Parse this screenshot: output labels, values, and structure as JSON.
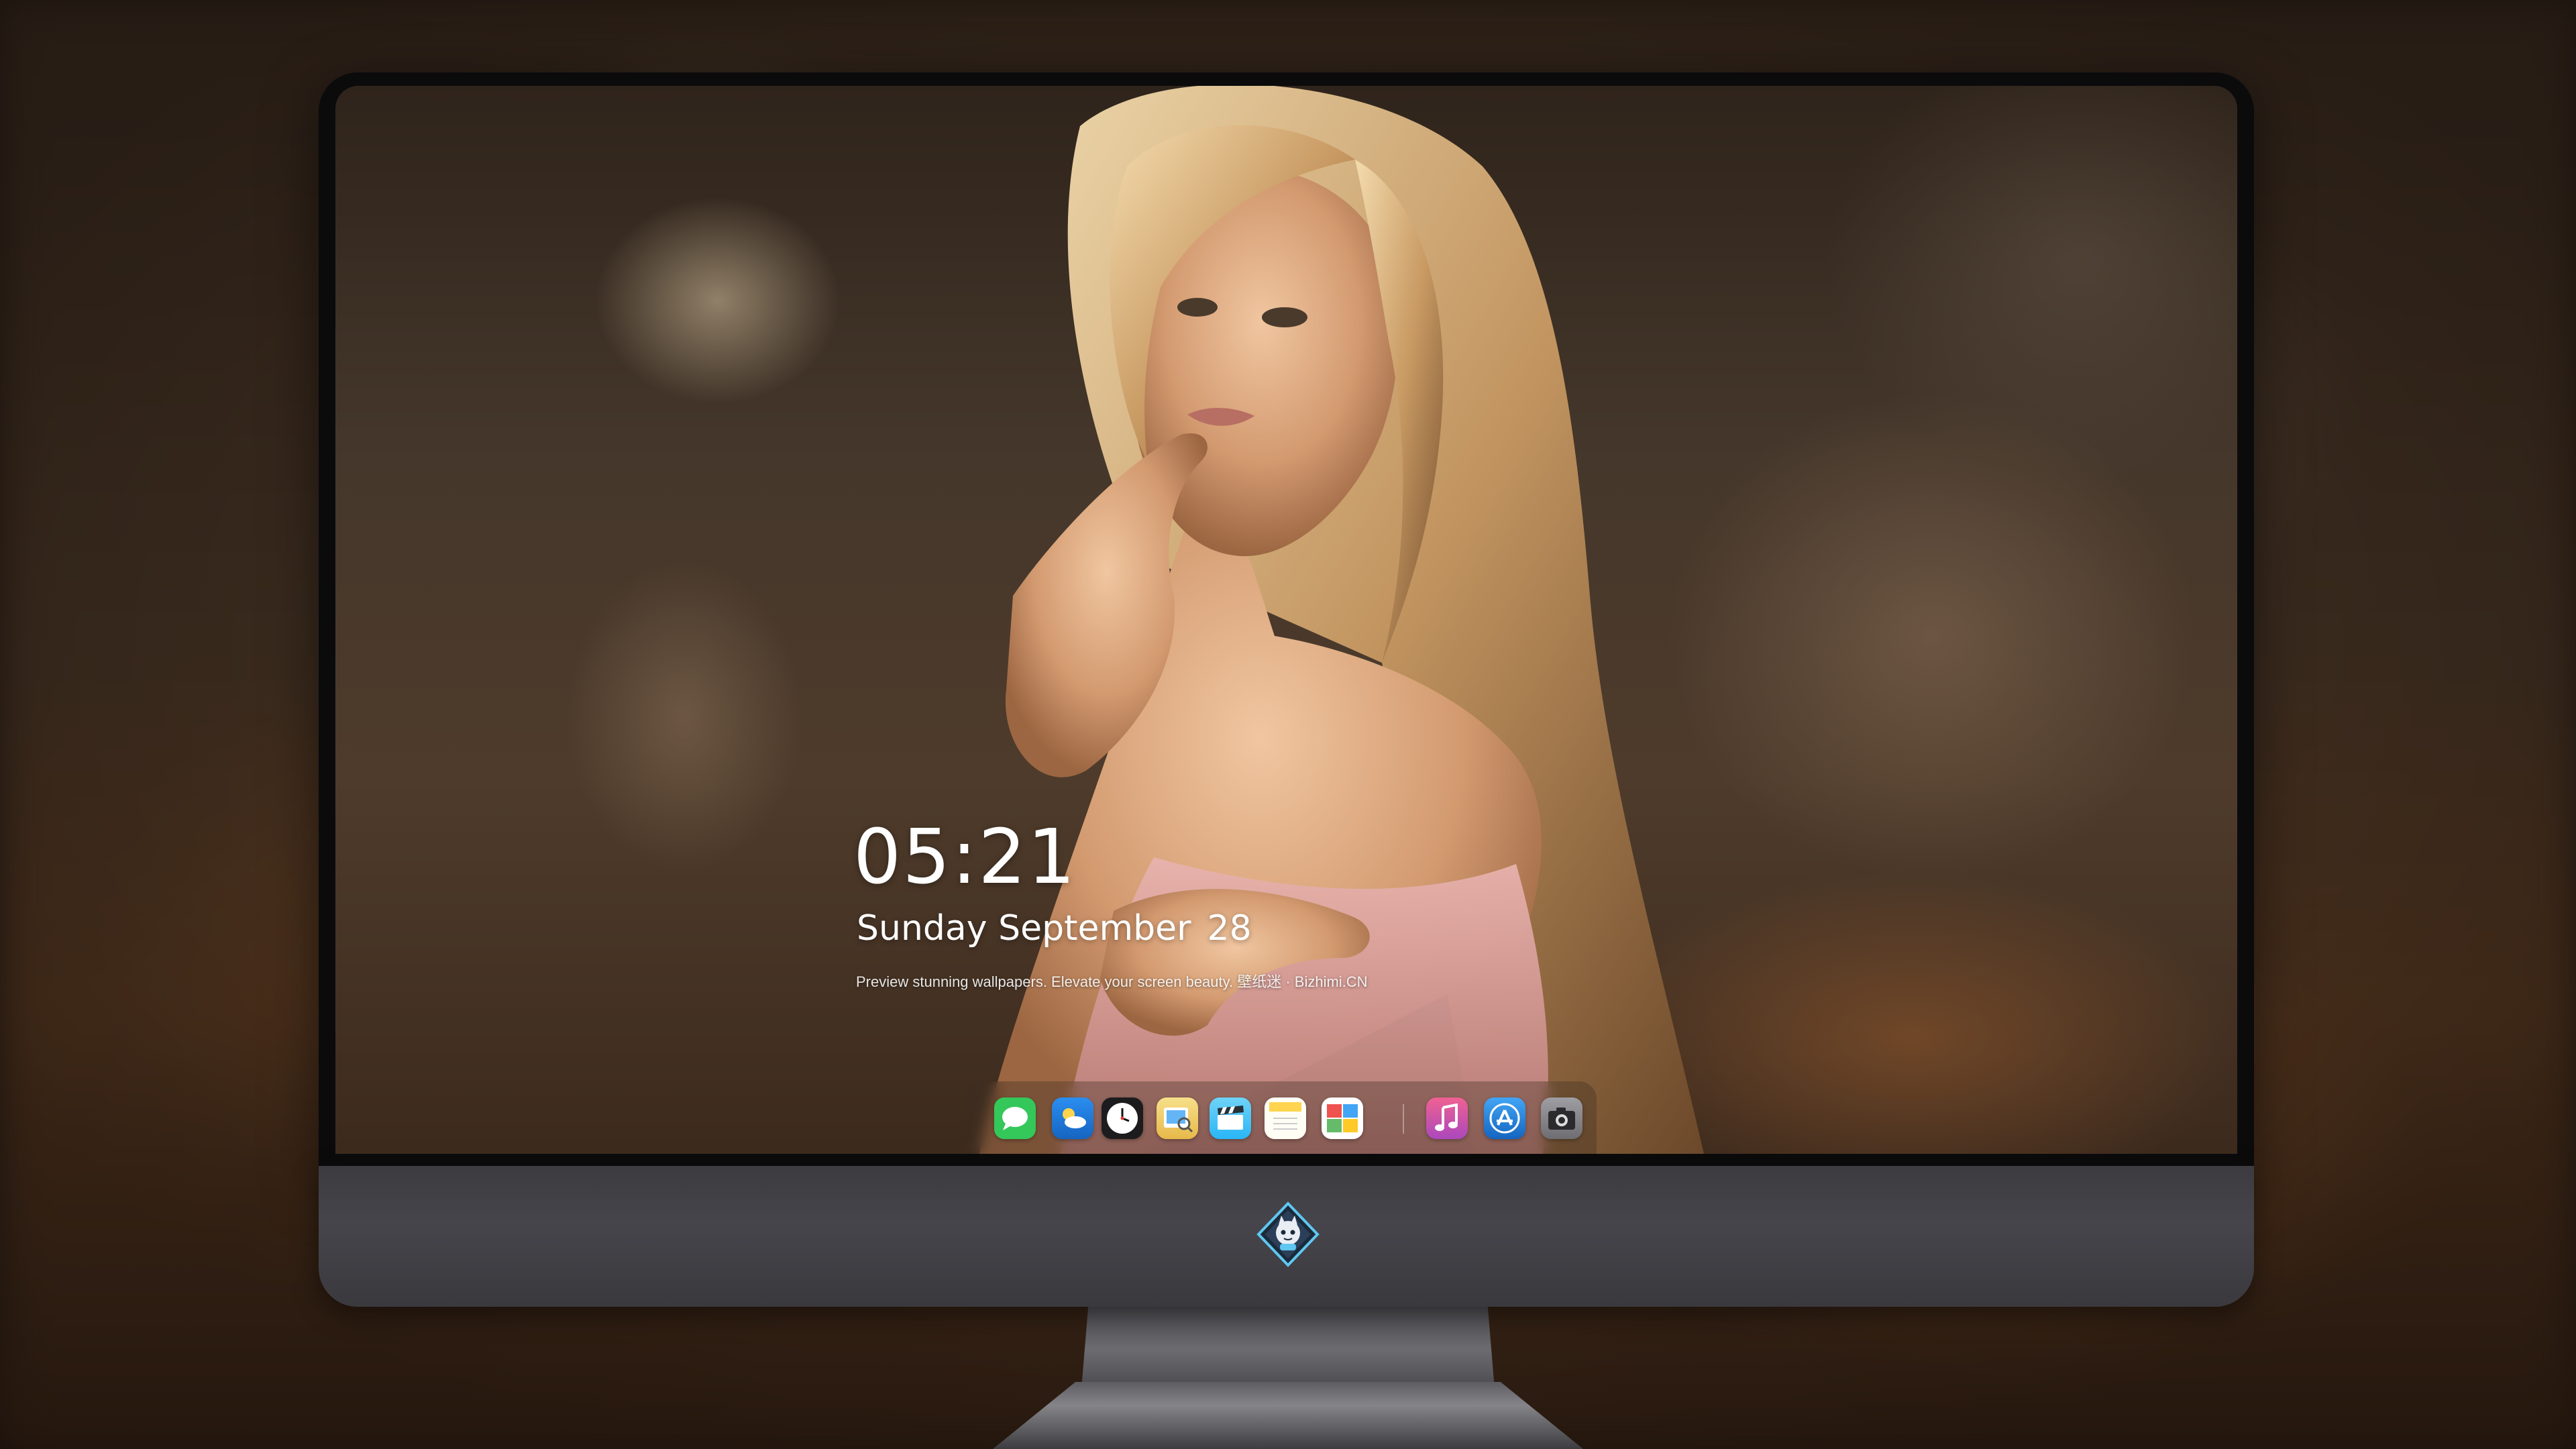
{
  "lock_screen": {
    "time": "05:21",
    "weekday_month": "Sunday September",
    "day": "28",
    "tagline": "Preview stunning wallpapers. Elevate your screen beauty. 壁纸迷 · Bizhimi.CN"
  },
  "dock": {
    "apps": [
      {
        "icon": "messages-icon",
        "color": "#34c759"
      },
      {
        "icon": "weather-icon",
        "color": "#1e88e5"
      },
      {
        "icon": "clock-icon",
        "color": "#1c1c1e"
      },
      {
        "icon": "preview-icon",
        "color": "#f5d36a"
      },
      {
        "icon": "video-clapper-icon",
        "color": "#4fc3f7"
      },
      {
        "icon": "notes-icon",
        "color": "#ffd54f"
      },
      {
        "icon": "photo-gallery-icon",
        "color": "#ffffff"
      },
      {
        "icon": "music-icon",
        "color": "#e040fb"
      },
      {
        "icon": "app-store-icon",
        "color": "#1e88e5"
      },
      {
        "icon": "camera-icon",
        "color": "#8e8e93"
      }
    ]
  },
  "colors": {
    "monitor_bezel": "#0b0b0c",
    "monitor_chin": "#3c3b40",
    "clock_text": "#ffffff"
  }
}
